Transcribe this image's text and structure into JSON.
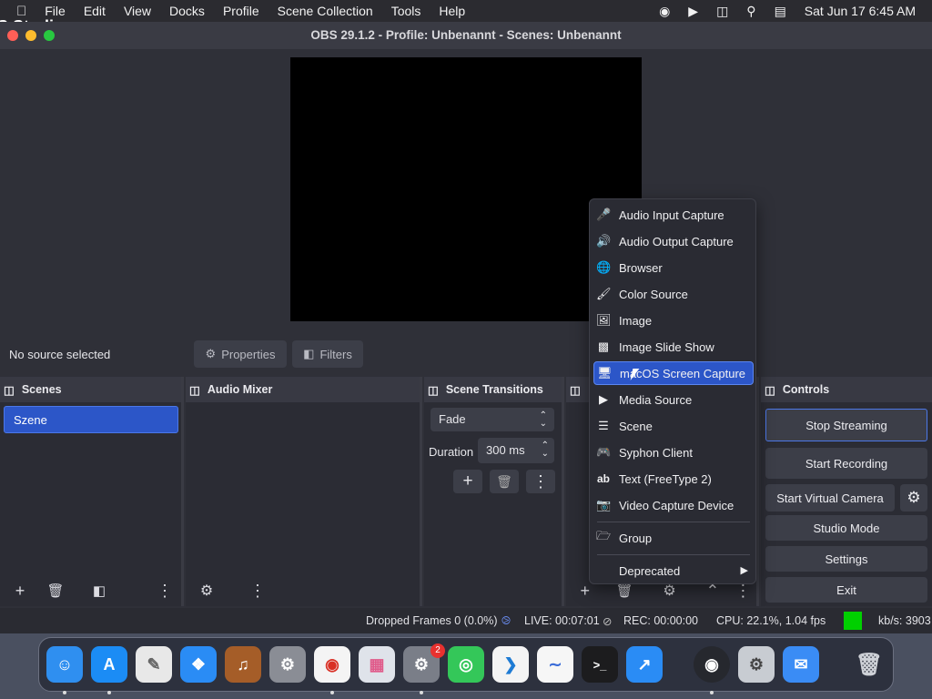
{
  "menubar": {
    "app_name": "OBS Studio",
    "items": [
      "File",
      "Edit",
      "View",
      "Docks",
      "Profile",
      "Scene Collection",
      "Tools",
      "Help"
    ],
    "clock": "Sat Jun 17  6:45 AM"
  },
  "window": {
    "title": "OBS 29.1.2 - Profile: Unbenannt - Scenes: Unbenannt"
  },
  "sourcebar": {
    "no_source": "No source selected",
    "properties": "Properties",
    "filters": "Filters"
  },
  "scenes": {
    "title": "Scenes",
    "items": [
      "Szene"
    ]
  },
  "mixer": {
    "title": "Audio Mixer"
  },
  "transitions": {
    "title": "Scene Transitions",
    "selected": "Fade",
    "duration_label": "Duration",
    "duration_value": "300 ms"
  },
  "controls": {
    "title": "Controls",
    "stop_streaming": "Stop Streaming",
    "start_recording": "Start Recording",
    "start_virtual_camera": "Start Virtual Camera",
    "studio_mode": "Studio Mode",
    "settings": "Settings",
    "exit": "Exit"
  },
  "menu": {
    "items": [
      {
        "label": "Audio Input Capture",
        "icon": "microphone-icon"
      },
      {
        "label": "Audio Output Capture",
        "icon": "speaker-icon"
      },
      {
        "label": "Browser",
        "icon": "globe-icon"
      },
      {
        "label": "Color Source",
        "icon": "paintbrush-icon"
      },
      {
        "label": "Image",
        "icon": "image-icon"
      },
      {
        "label": "Image Slide Show",
        "icon": "slideshow-icon"
      },
      {
        "label": "macOS Screen Capture",
        "icon": "monitor-icon"
      },
      {
        "label": "Media Source",
        "icon": "play-icon"
      },
      {
        "label": "Scene",
        "icon": "list-icon"
      },
      {
        "label": "Syphon Client",
        "icon": "gamepad-icon"
      },
      {
        "label": "Text (FreeType 2)",
        "icon": "text-icon"
      },
      {
        "label": "Video Capture Device",
        "icon": "camera-icon"
      },
      {
        "label": "Group",
        "icon": "folder-icon"
      },
      {
        "label": "Deprecated",
        "icon": "submenu-arrow-icon"
      }
    ]
  },
  "status": {
    "dropped": "Dropped Frames 0 (0.0%)",
    "live": "LIVE: 00:07:01",
    "rec": "REC: 00:00:00",
    "cpu": "CPU: 22.1%, 1.04 fps",
    "kbs": "kb/s: 3903"
  },
  "dock_badge": "2",
  "colors": {
    "accent": "#2c56c8",
    "status_green": "#00d000",
    "close": "#ff5f57",
    "minimize": "#febc2e",
    "zoom": "#28c840"
  }
}
